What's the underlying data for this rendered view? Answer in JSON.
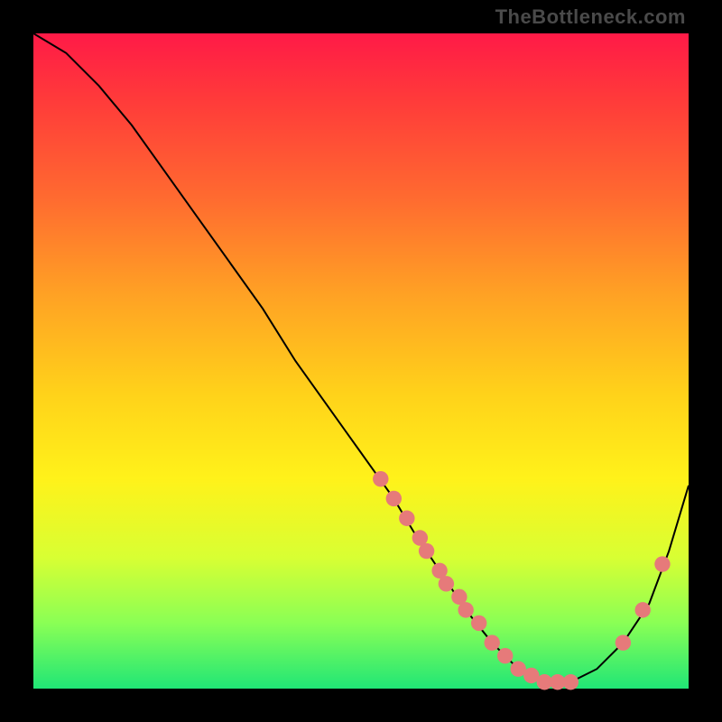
{
  "watermark": "TheBottleneck.com",
  "palette": {
    "background": "#000000",
    "curve": "#000000",
    "dots": "#e67a7a"
  },
  "chart_data": {
    "type": "line",
    "title": "",
    "xlabel": "",
    "ylabel": "",
    "xlim": [
      0,
      100
    ],
    "ylim": [
      0,
      100
    ],
    "grid": false,
    "legend": false,
    "series": [
      {
        "name": "bottleneck-curve",
        "x": [
          0,
          5,
          10,
          15,
          20,
          25,
          30,
          35,
          40,
          45,
          50,
          55,
          58,
          62,
          66,
          70,
          74,
          78,
          82,
          86,
          90,
          94,
          97,
          100
        ],
        "y": [
          100,
          97,
          92,
          86,
          79,
          72,
          65,
          58,
          50,
          43,
          36,
          29,
          24,
          18,
          12,
          7,
          3,
          1,
          1,
          3,
          7,
          13,
          21,
          31
        ]
      }
    ],
    "highlight_points": {
      "name": "sampled-datapoints",
      "x": [
        53,
        55,
        57,
        59,
        60,
        62,
        63,
        65,
        66,
        68,
        70,
        72,
        74,
        76,
        78,
        80,
        82,
        90,
        93,
        96
      ],
      "y": [
        32,
        29,
        26,
        23,
        21,
        18,
        16,
        14,
        12,
        10,
        7,
        5,
        3,
        2,
        1,
        1,
        1,
        7,
        12,
        19
      ]
    }
  }
}
